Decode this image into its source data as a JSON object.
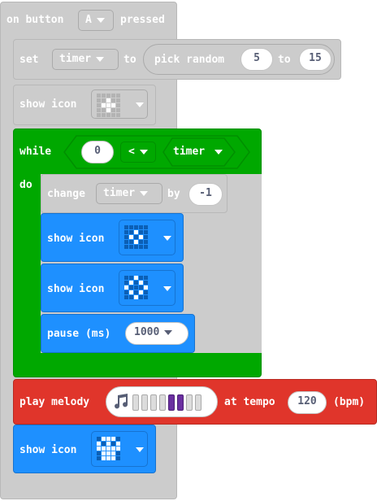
{
  "colors": {
    "grey": "#cccccc",
    "grey_dark": "#b8b8b8",
    "green": "#00a800",
    "green_dark": "#008f00",
    "blue": "#1e90ff",
    "blue_dark": "#1673d1",
    "red": "#e0352b",
    "red_dark": "#b82a21",
    "purple": "#6a2fa0",
    "text_dark": "#575e75"
  },
  "event": {
    "label": "on button",
    "button_value": "A",
    "suffix": "pressed"
  },
  "set_block": {
    "label": "set",
    "variable": "timer",
    "to": "to",
    "pick_random": "pick random",
    "min": "5",
    "and": "to",
    "max": "15"
  },
  "show_icon_1": {
    "label": "show icon",
    "icon": "small-diamond-icon"
  },
  "while_block": {
    "label": "while",
    "left": "0",
    "operator": "<",
    "right": "timer",
    "do_label": "do"
  },
  "change_block": {
    "label": "change",
    "variable": "timer",
    "by": "by",
    "amount": "-1"
  },
  "show_icon_2": {
    "label": "show icon",
    "icon": "diamond-icon"
  },
  "show_icon_3": {
    "label": "show icon",
    "icon": "large-diamond-icon"
  },
  "pause_block": {
    "label": "pause (ms)",
    "value": "1000"
  },
  "melody_block": {
    "label": "play melody",
    "at_tempo": "at tempo",
    "tempo": "120",
    "unit": "(bpm)",
    "notes_active_index": [
      4,
      5
    ]
  },
  "show_icon_4": {
    "label": "show icon",
    "icon": "skull-icon"
  }
}
